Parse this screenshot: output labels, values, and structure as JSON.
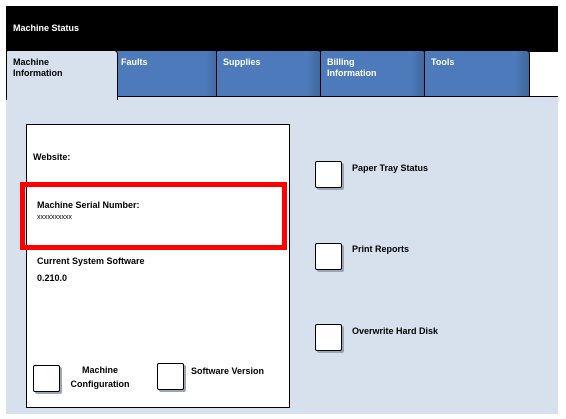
{
  "window": {
    "title": "Machine Status"
  },
  "tabs": [
    {
      "line1": "Machine",
      "line2": "Information",
      "active": true
    },
    {
      "line1": "Faults",
      "line2": ""
    },
    {
      "line1": "Supplies",
      "line2": ""
    },
    {
      "line1": "Billing",
      "line2": "Information"
    },
    {
      "line1": "Tools",
      "line2": ""
    }
  ],
  "info": {
    "website_label": "Website:",
    "serial_label": "Machine Serial Number:",
    "serial_value": "xxxxxxxxxx",
    "software_label": "Current System Software",
    "software_value": "0.210.0"
  },
  "buttons": {
    "machine_config_line1": "Machine",
    "machine_config_line2": "Configuration",
    "software_version": "Software Version",
    "paper_tray": "Paper Tray Status",
    "print_reports": "Print Reports",
    "overwrite_disk": "Overwrite Hard Disk"
  },
  "colors": {
    "title_bar": "#000000",
    "tab_inactive": "#4c7aba",
    "panel": "#d7e1ee",
    "highlight": "#ff0000"
  }
}
